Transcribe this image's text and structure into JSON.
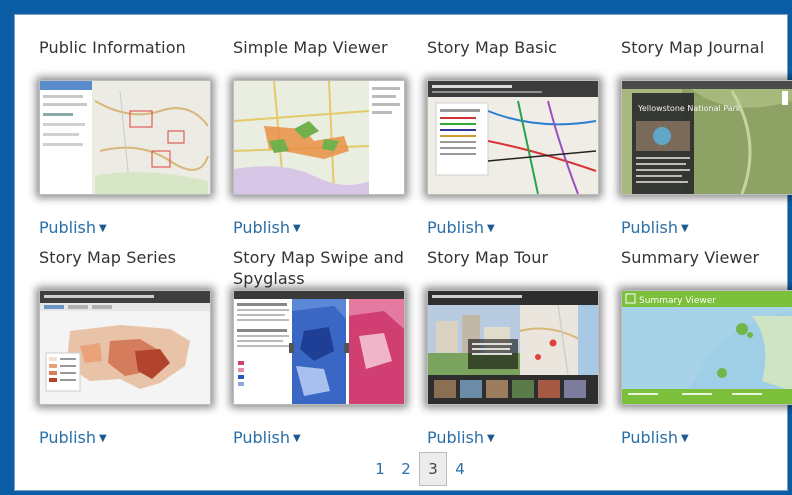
{
  "templates": [
    {
      "title": "Public Information",
      "action": "Publish"
    },
    {
      "title": "Simple Map Viewer",
      "action": "Publish"
    },
    {
      "title": "Story Map Basic",
      "action": "Publish"
    },
    {
      "title": "Story Map Journal",
      "action": "Publish"
    },
    {
      "title": "Story Map Series",
      "action": "Publish"
    },
    {
      "title": "Story Map Swipe and Spyglass",
      "action": "Publish"
    },
    {
      "title": "Story Map Tour",
      "action": "Publish"
    },
    {
      "title": "Summary Viewer",
      "action": "Publish"
    }
  ],
  "thumbnail_text": {
    "journal": "Yellowstone National Park",
    "summary": "Summary Viewer"
  },
  "pagination": {
    "pages": [
      "1",
      "2",
      "3",
      "4"
    ],
    "current": "3"
  },
  "icons": {
    "publish_caret": "caret-down-icon"
  },
  "colors": {
    "frame_bg": "#0b5ea6",
    "link": "#2a6fa8"
  }
}
